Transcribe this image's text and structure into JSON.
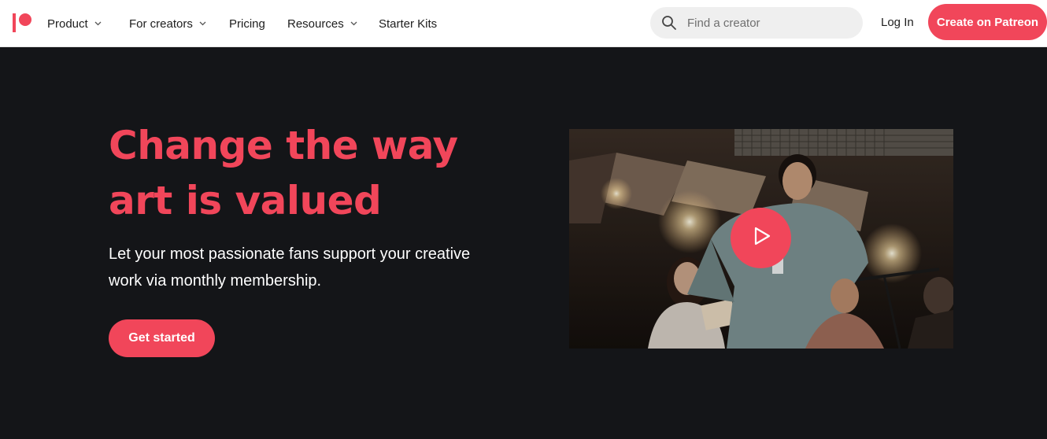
{
  "brand": {
    "accent": "#f1465a",
    "logo_icon": "patreon-logo-icon"
  },
  "nav": {
    "items": [
      {
        "label": "Product",
        "has_dropdown": true
      },
      {
        "label": "For creators",
        "has_dropdown": true
      },
      {
        "label": "Pricing",
        "has_dropdown": false
      },
      {
        "label": "Resources",
        "has_dropdown": true
      },
      {
        "label": "Starter Kits",
        "has_dropdown": false
      }
    ],
    "search": {
      "placeholder": "Find a creator",
      "value": "",
      "icon": "search-icon"
    },
    "login_label": "Log In",
    "cta_label": "Create on Patreon"
  },
  "hero": {
    "title_line1": "Change the way",
    "title_line2": "art is valued",
    "subtitle_line1": "Let your most passionate fans support your creative",
    "subtitle_line2": "work via monthly membership.",
    "button_label": "Get started"
  },
  "video": {
    "play_icon": "play-icon"
  }
}
